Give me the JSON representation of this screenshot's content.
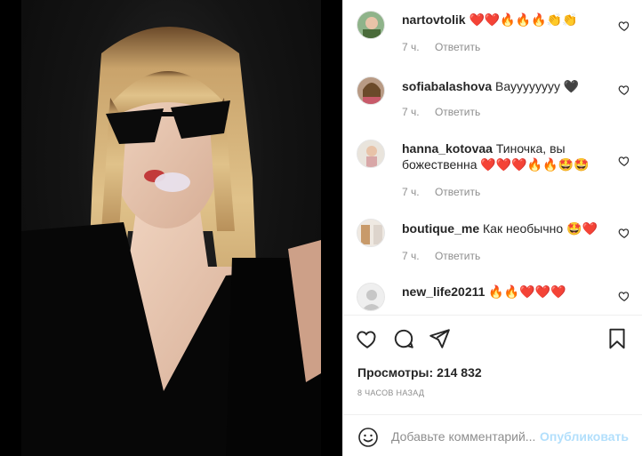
{
  "comments": [
    {
      "username": "nartovtolik",
      "text": "",
      "emoji": "❤️❤️🔥🔥🔥👏👏",
      "time": "7 ч.",
      "reply": "Ответить"
    },
    {
      "username": "sofiabalashova",
      "text": "Вауууууууу",
      "emoji": "🖤",
      "time": "7 ч.",
      "reply": "Ответить"
    },
    {
      "username": "hanna_kotovaa",
      "text": "Тиночка, вы божественна",
      "emoji": "❤️❤️❤️🔥🔥🤩🤩",
      "time": "7 ч.",
      "reply": "Ответить"
    },
    {
      "username": "boutique_me",
      "text": "Как необычно",
      "emoji": "🤩❤️",
      "time": "7 ч.",
      "reply": "Ответить"
    },
    {
      "username": "new_life20211",
      "text": "",
      "emoji": "🔥🔥❤️❤️❤️",
      "time": "",
      "reply": ""
    }
  ],
  "stats": {
    "views_label": "Просмотры:",
    "views_count": "214 832",
    "time_ago": "8 часов назад"
  },
  "add_comment": {
    "placeholder": "Добавьте комментарий...",
    "post_label": "Опубликовать"
  },
  "icons": {
    "like": "heart-outline-icon",
    "comment": "comment-bubble-icon",
    "share": "paper-plane-icon",
    "save": "bookmark-icon",
    "emoji": "smiley-icon"
  },
  "colors": {
    "text": "#262626",
    "muted": "#8e8e8e",
    "post_button_disabled": "#b2dffc",
    "divider": "#efefef"
  }
}
